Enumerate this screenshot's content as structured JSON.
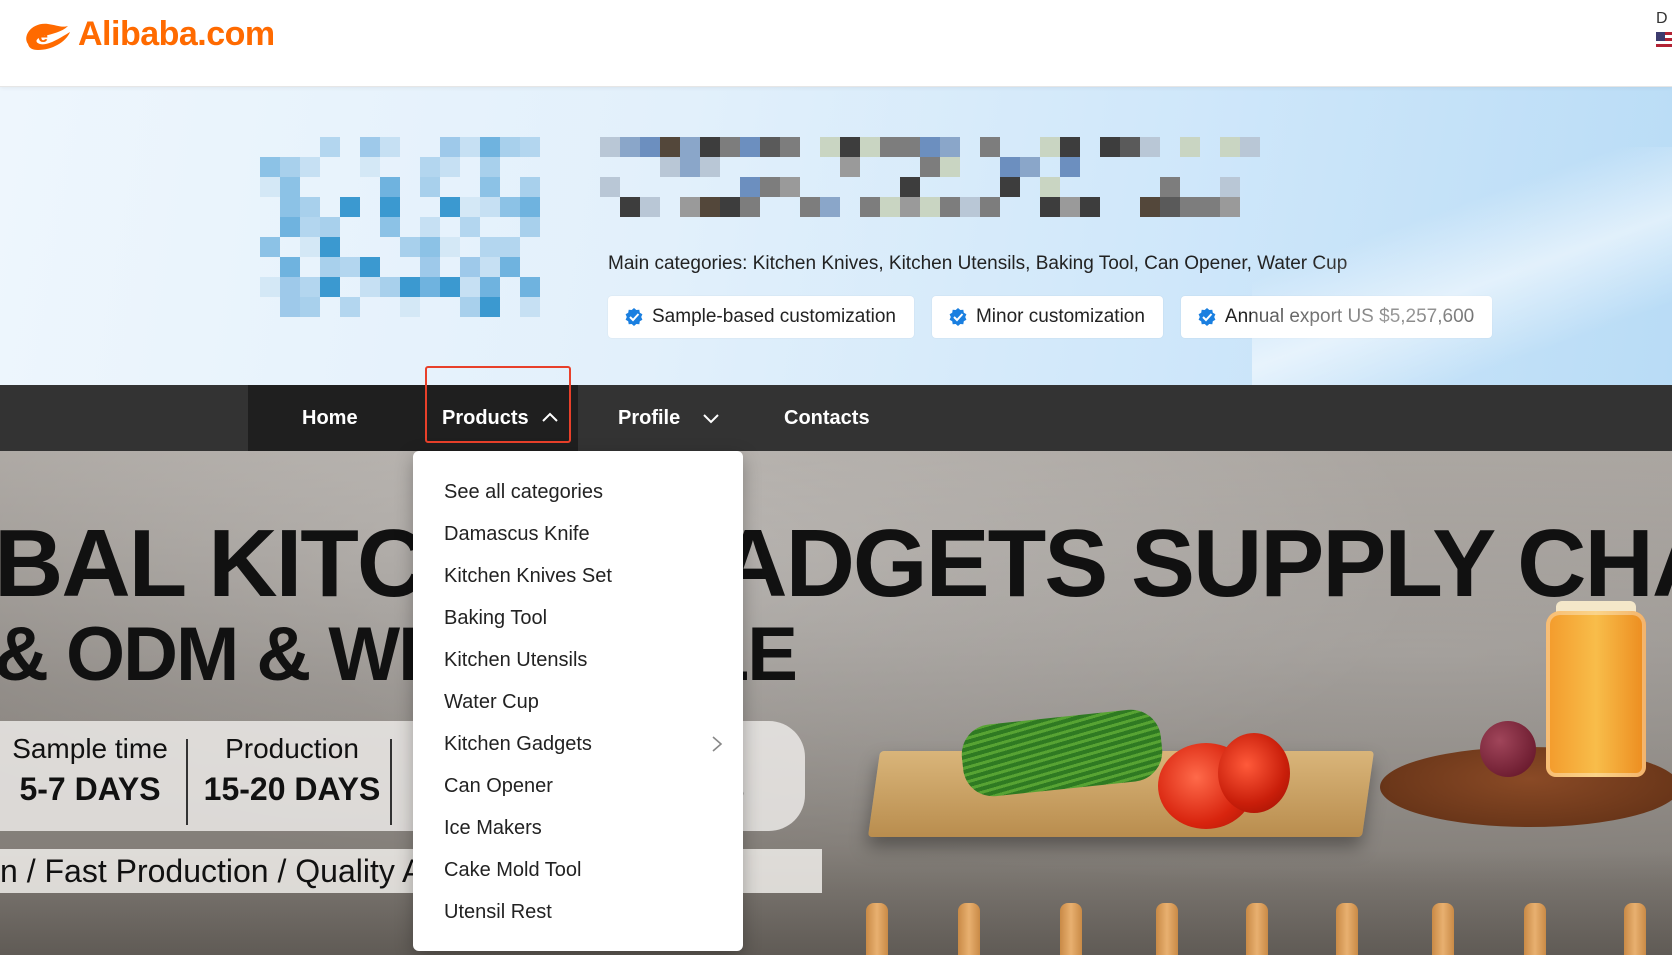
{
  "header": {
    "logo_text": "Alibaba.com",
    "right_clip_text": "D"
  },
  "supplier": {
    "main_categories": "Main categories: Kitchen Knives, Kitchen Utensils, Baking Tool, Can Opener, Water Cup",
    "badges": [
      {
        "label": "Sample-based customization",
        "icon": "verified-icon"
      },
      {
        "label": "Minor customization",
        "icon": "verified-icon"
      },
      {
        "label": "Annual export US $5,257,600",
        "icon": "verified-icon"
      }
    ]
  },
  "nav": {
    "home": "Home",
    "products": "Products",
    "profile": "Profile",
    "contacts": "Contacts"
  },
  "products_menu": {
    "items": [
      "See all categories",
      "Damascus Knife",
      "Kitchen Knives Set",
      "Baking Tool",
      "Kitchen Utensils",
      "Water Cup",
      "Kitchen Gadgets",
      "Can Opener",
      "Ice Makers",
      "Cake Mold Tool",
      "Utensil Rest"
    ],
    "submenu_item_index": 6
  },
  "hero": {
    "headline_line1": "BAL KITCHEN GADGETS SUPPLY CHAIN",
    "headline_line2": "& ODM & WHOLESALE",
    "stats": [
      {
        "label": "Sample time",
        "value": "5-7 DAYS"
      },
      {
        "label": "Production",
        "value": "15-20 DAYS"
      },
      {
        "label": "ces",
        "value": "RS"
      }
    ],
    "tagline": "n / Fast Production / Quality Assurance / Service"
  },
  "colors": {
    "brand_orange": "#ff6a00",
    "nav_bg": "#333333",
    "highlight_red": "#e8402a",
    "verified_blue": "#1a7fe0"
  }
}
